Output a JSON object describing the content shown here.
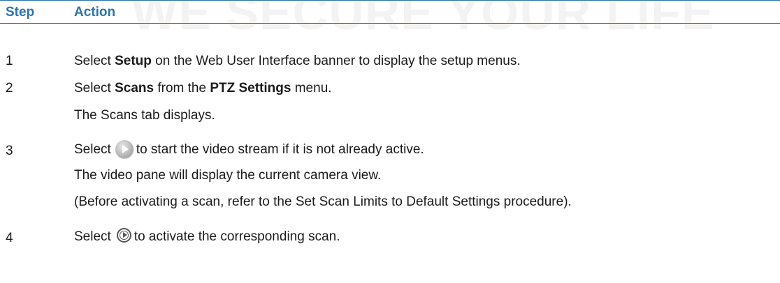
{
  "watermark": "WE SECURE YOUR LIFE",
  "header": {
    "step": "Step",
    "action": "Action"
  },
  "steps": [
    {
      "number": "1",
      "pre": "Select ",
      "bold1": "Setup",
      "post": " on the Web User Interface banner to display the setup menus."
    },
    {
      "number": "2",
      "pre": "Select ",
      "bold1": "Scans",
      "mid": " from the ",
      "bold2": "PTZ Settings",
      "post": " menu.",
      "result": "The Scans tab displays."
    },
    {
      "number": "3",
      "pre": "Select",
      "icon": "play-icon",
      "post": "to start the video stream if it is not already active.",
      "result": "The video pane will display the current camera view.",
      "note": "(Before activating a scan, refer to the Set Scan Limits to Default Settings procedure)."
    },
    {
      "number": "4",
      "pre": "Select",
      "icon": "scan-activate-icon",
      "post": "to activate the corresponding scan."
    }
  ],
  "colors": {
    "header_text": "#2a74ad",
    "rule": "#2a74ad",
    "body_text": "#1a1a1a"
  }
}
